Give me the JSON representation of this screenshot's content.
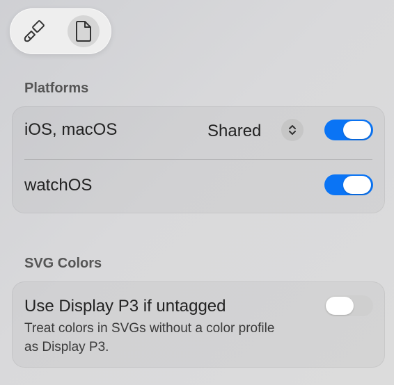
{
  "toolbar": {
    "tools": [
      {
        "icon": "paintbrush-icon"
      },
      {
        "icon": "document-icon",
        "selected": true
      }
    ]
  },
  "platforms": {
    "title": "Platforms",
    "rows": [
      {
        "label": "iOS, macOS",
        "value": "Shared",
        "enabled": true
      },
      {
        "label": "watchOS",
        "enabled": true
      }
    ]
  },
  "svg_colors": {
    "title": "SVG Colors",
    "option_label": "Use Display P3 if untagged",
    "description": "Treat colors in SVGs without a color profile as Display P3.",
    "enabled": false
  },
  "colors": {
    "toggle_on": "#0a74f5",
    "toggle_off": "#cfcfcf"
  }
}
